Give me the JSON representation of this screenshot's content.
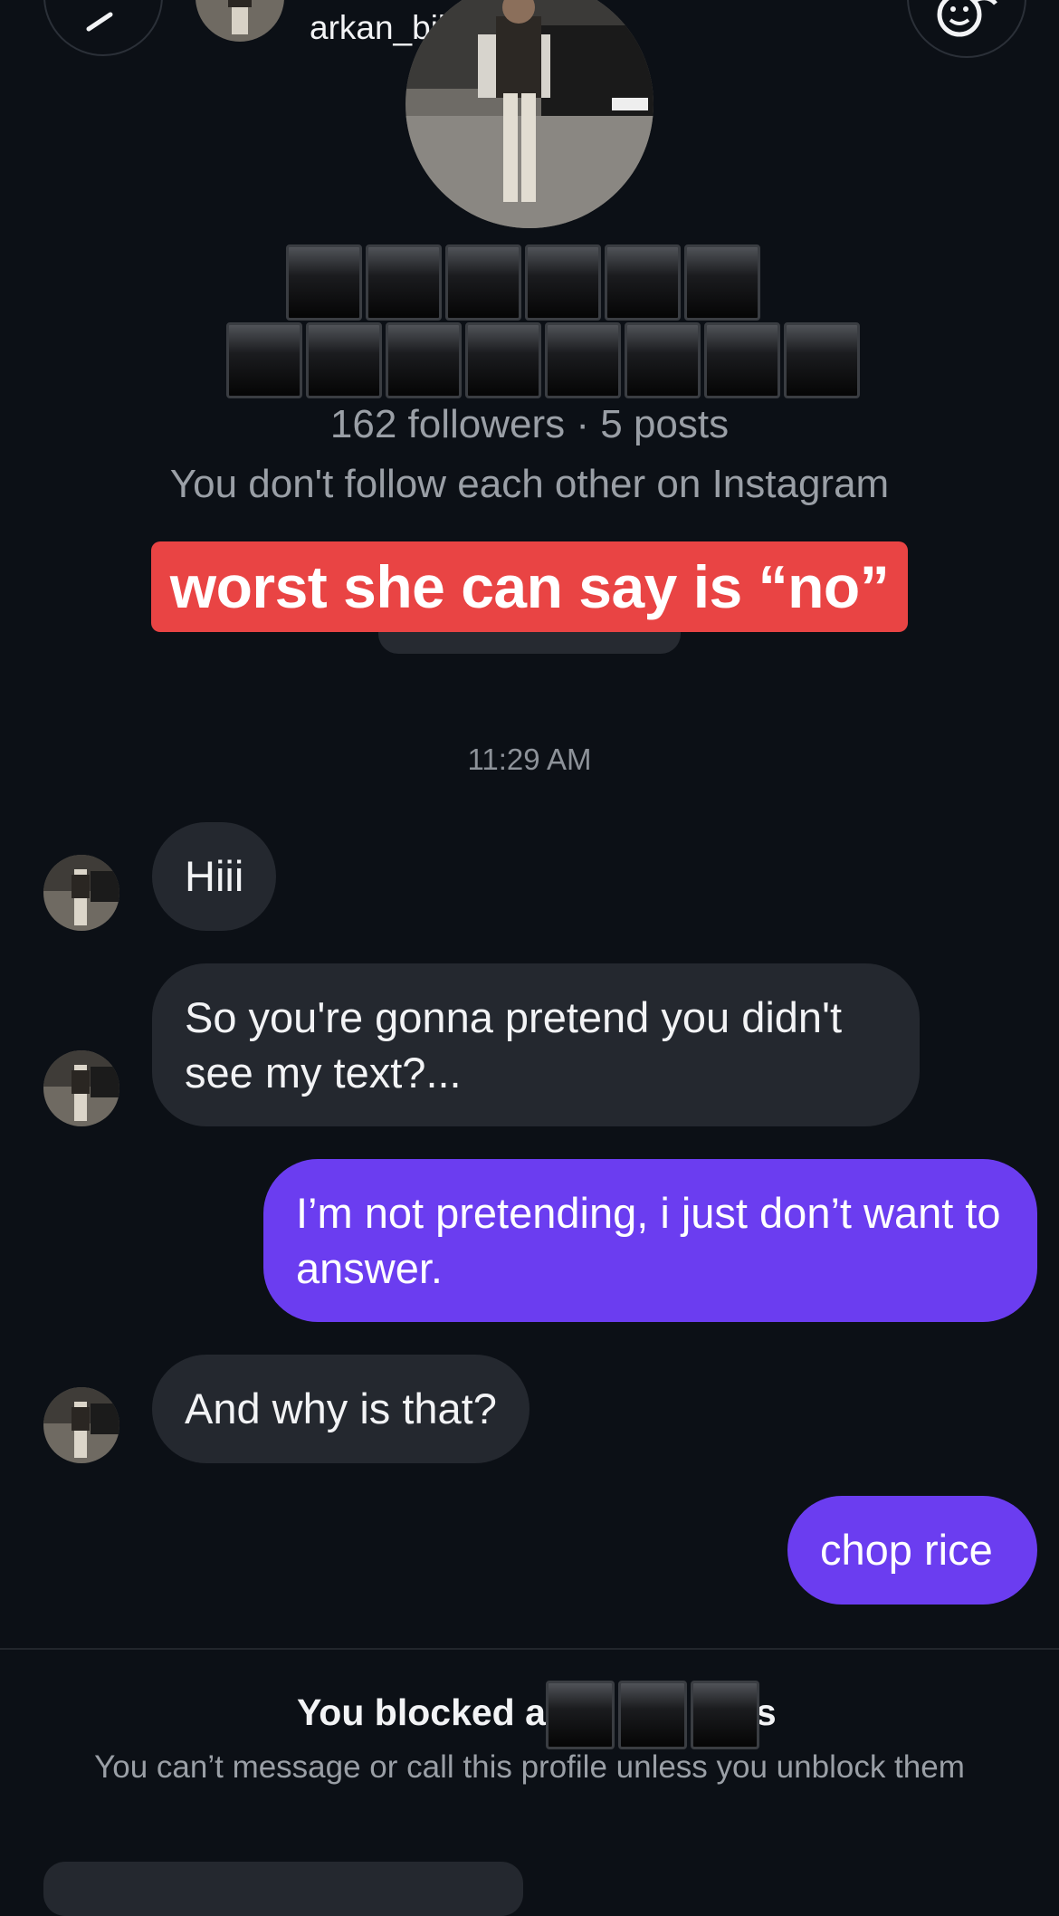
{
  "header": {
    "username": "arkan_bilbas"
  },
  "profile": {
    "stats": "162 followers · 5 posts",
    "relationship": "You don't follow each other on Instagram"
  },
  "overlay_caption": "worst she can say is “no”",
  "chat": {
    "timestamp": "11:29 AM",
    "messages": [
      {
        "from": "them",
        "text": "Hiii"
      },
      {
        "from": "them",
        "text": "So you're gonna pretend you didn't see my text?..."
      },
      {
        "from": "me",
        "text": "I’m not pretending, i just don’t want to answer."
      },
      {
        "from": "them",
        "text": "And why is that?"
      },
      {
        "from": "me",
        "text": "chop rice"
      }
    ]
  },
  "blocked": {
    "title_prefix": "You blocked a",
    "title_suffix": "s",
    "subtitle": "You can’t message or call this profile unless you unblock them"
  },
  "colors": {
    "background": "#0c1016",
    "received_bubble": "#24282f",
    "sent_bubble": "#6b3df0",
    "caption_background": "#e94444"
  }
}
